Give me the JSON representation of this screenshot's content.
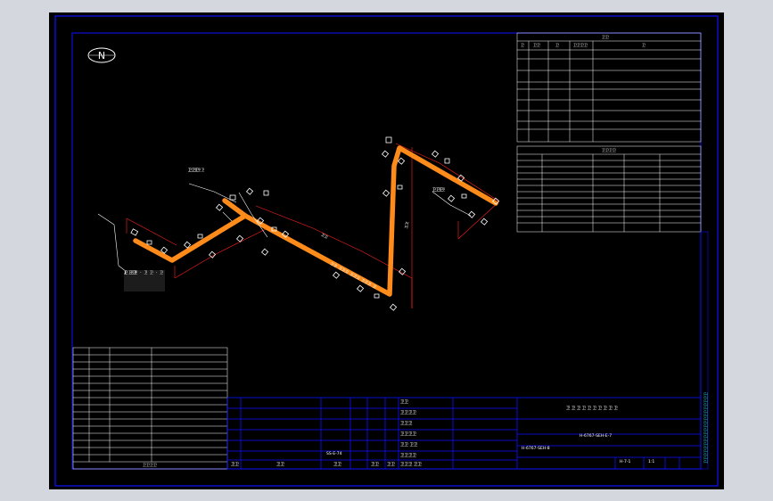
{
  "colors": {
    "outer_background": "#d4d8de",
    "sheet_background": "#000000",
    "frame_lines": "#1010ff",
    "pipe": "#ff8c1a",
    "dimension_lines": "#ff2020",
    "cyan_text": "#27e6e6",
    "white_text": "#ffffff"
  },
  "north_arrow": {
    "letter": "N",
    "icon": "north-arrow-icon"
  },
  "piping_diagram": {
    "callout_left": [
      "卫",
      "卫 · 卫 · 卫 卫 · 卫",
      "1 卫卫",
      "卫 卫卫"
    ],
    "callout_mid_upper": [
      "卫卫",
      "卫卫卫",
      "卫卫卫",
      "卫 卫卫卫"
    ],
    "callout_right": [
      "卫卫卫",
      "卫卫",
      "卫卫卫",
      "卫 卫卫"
    ],
    "pipe_tag_diagonal": "卫卫 卫卫卫 卫卫卫 卫卫卫 卫",
    "pipe_tag_short": "卫卫",
    "pipe_tag_vertical": "卫卫"
  },
  "spec_table": {
    "title": "卫卫",
    "headers": [
      "卫",
      "卫卫",
      "卫",
      "卫卫卫卫",
      "卫"
    ]
  },
  "material_table": {
    "title": "卫卫卫卫",
    "rows_count_label": "11"
  },
  "parts_list": {
    "footer_label": "卫卫卫卫"
  },
  "title_block": {
    "drawing_title": "卫 卫 卫 卫 卫 卫 卫 卫 卫 卫",
    "drawing_number": "H-6767-SEH-E-7",
    "sub_number": "H-6767-SEH-8",
    "project_code": "SS-E-74",
    "scale": "1:1",
    "sheet_label": "H-7-1",
    "rows": [
      "卫卫",
      "卫卫卫卫",
      "卫卫卫",
      "卫卫卫卫",
      "卫卫 卫卫",
      "卫卫卫卫",
      "卫卫卫 卫卫"
    ],
    "bottom_labels": [
      "卫卫",
      "卫卫",
      "卫卫",
      "卫卫",
      "卫卫"
    ]
  },
  "side_strip_text": "卫卫卫卫卫卫卫卫卫卫卫卫卫卫卫卫卫卫卫卫"
}
